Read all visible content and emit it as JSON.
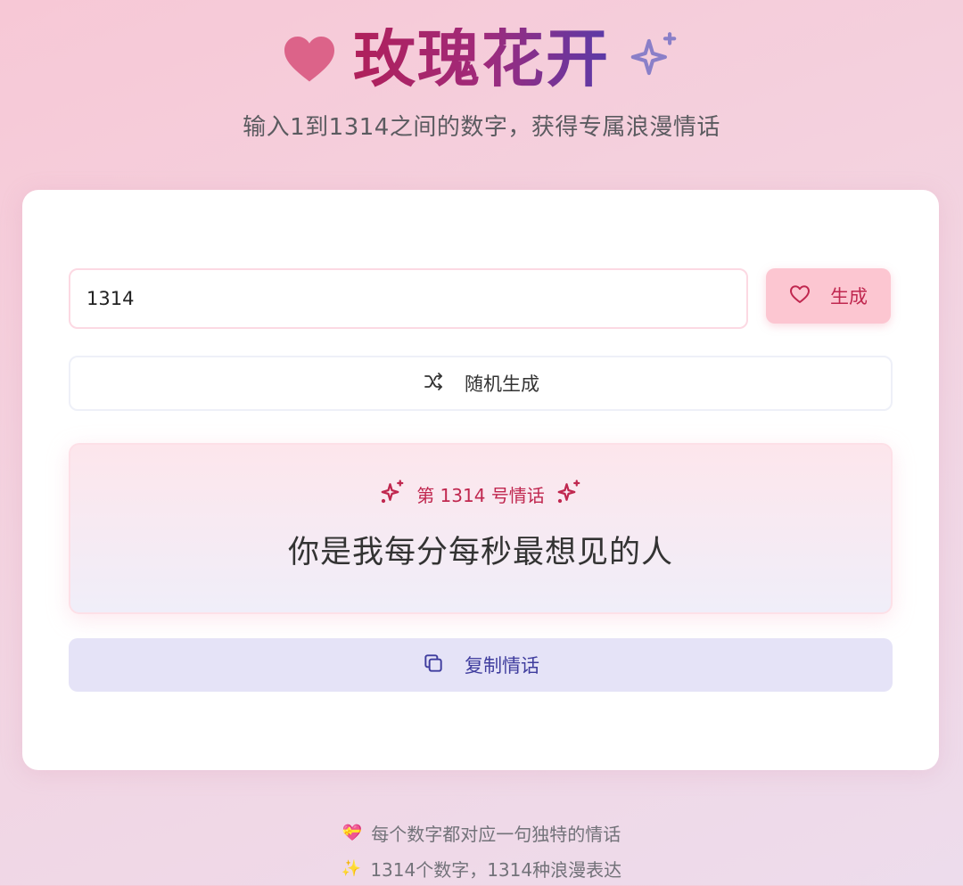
{
  "header": {
    "title": "玫瑰花开",
    "subtitle": "输入1到1314之间的数字，获得专属浪漫情话",
    "left_icon": "heart-icon",
    "right_icon": "sparkles-icon",
    "accent": "#c0274f"
  },
  "form": {
    "number_value": "1314",
    "generate_label": "生成",
    "random_label": "随机生成"
  },
  "result": {
    "label_prefix": "第",
    "number": "1314",
    "label_suffix": "号情话",
    "text": "你是我每分每秒最想见的人"
  },
  "copy": {
    "label": "复制情话"
  },
  "footer": {
    "line1_emoji": "💝",
    "line1": "每个数字都对应一句独特的情话",
    "line2_emoji": "✨",
    "line2": "1314个数字，1314种浪漫表达"
  }
}
